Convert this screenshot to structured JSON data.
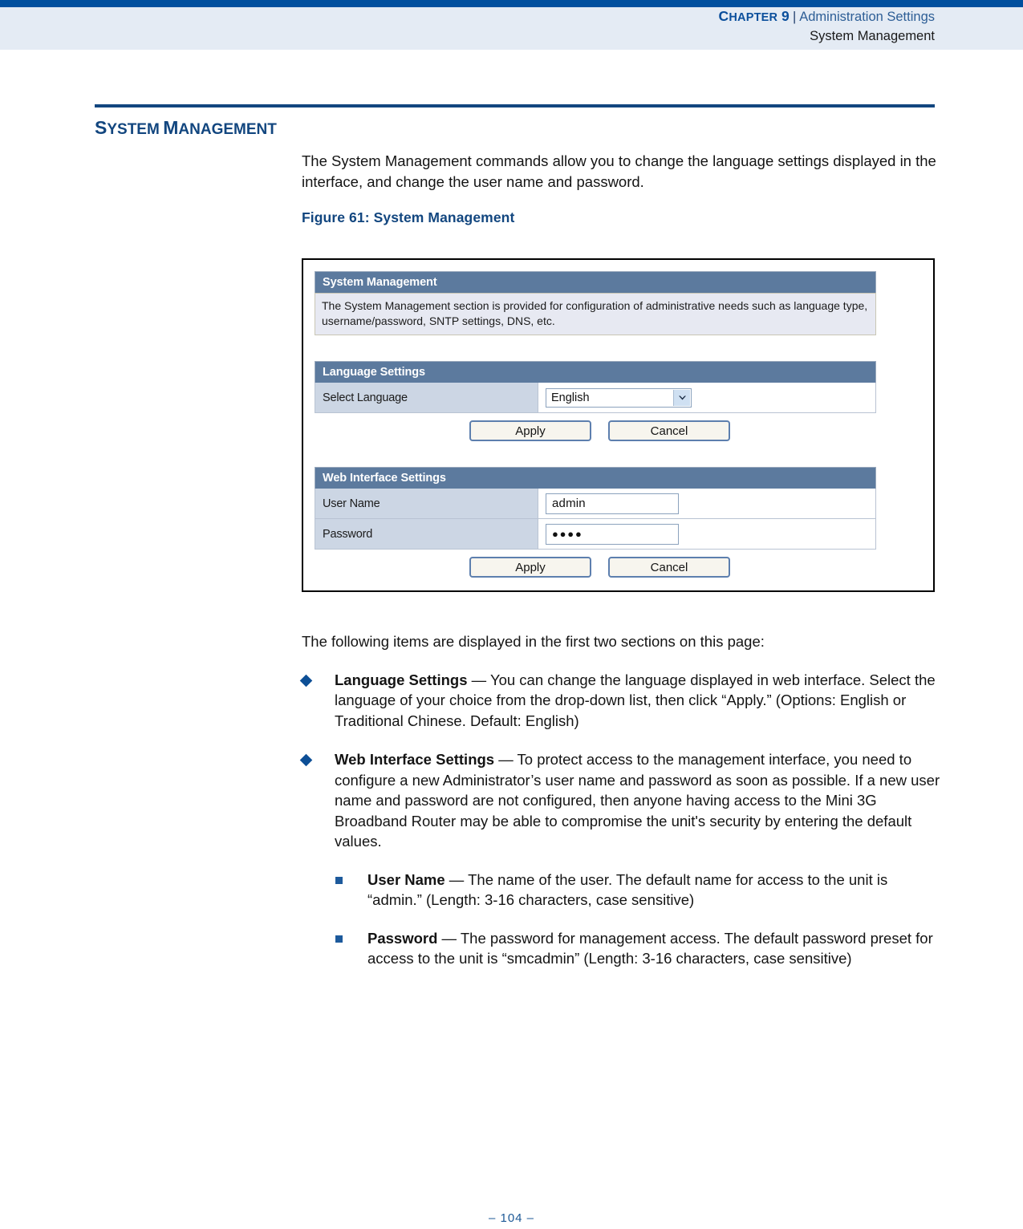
{
  "header": {
    "chapter_prefix_big": "C",
    "chapter_prefix_rest": "HAPTER",
    "chapter_number": "9",
    "separator": "|",
    "chapter_title": "Administration Settings",
    "subtitle": "System Management"
  },
  "section": {
    "title_parts": [
      {
        "big": "S",
        "small": "YSTEM"
      },
      {
        "big": "M",
        "small": "ANAGEMENT"
      }
    ],
    "title_plain": "SYSTEM MANAGEMENT"
  },
  "intro": {
    "paragraph": "The System Management commands allow you to change the language settings displayed in the interface, and change the user name and password."
  },
  "figure": {
    "caption": "Figure 61:  System Management",
    "ui": {
      "panel_title": "System Management",
      "panel_description": "The System Management section is provided for configuration of administrative needs such as language type, username/password, SNTP settings, DNS, etc.",
      "language_section": {
        "title": "Language Settings",
        "label": "Select Language",
        "selected_value": "English",
        "apply_label": "Apply",
        "cancel_label": "Cancel"
      },
      "web_section": {
        "title": "Web Interface Settings",
        "username_label": "User Name",
        "username_value": "admin",
        "password_label": "Password",
        "password_value": "●●●●",
        "apply_label": "Apply",
        "cancel_label": "Cancel"
      }
    }
  },
  "body": {
    "lead_in": "The following items are displayed in the first two sections on this page:",
    "bullets": [
      {
        "term": "Language Settings",
        "dash": " — ",
        "text": "You can change the language displayed in web interface. Select the language of your choice from the drop-down list, then click “Apply.” (Options: English or Traditional Chinese. Default: English)"
      },
      {
        "term": "Web Interface Settings",
        "dash": " — ",
        "text": "To protect access to the management interface, you need to configure a new Administrator’s user name and password as soon as possible. If a new user name and password are not configured, then anyone having access to the Mini 3G Broadband Router may be able to compromise the unit's security by entering the default values.",
        "sub_bullets": [
          {
            "term": "User Name",
            "dash": " — ",
            "text": "The name of the user. The default name for access to the unit is “admin.” (Length: 3-16 characters, case sensitive)"
          },
          {
            "term": "Password",
            "dash": " — ",
            "text": "The password for management access. The default password preset for access to the unit is “smcadmin” (Length: 3-16 characters, case sensitive)"
          }
        ]
      }
    ]
  },
  "footer": {
    "page_number": "–  104  –"
  },
  "colors": {
    "header_rule": "#004f9e",
    "header_band": "#e4ebf4",
    "heading_blue": "#12467f",
    "link_blue": "#2d5e96",
    "panel_title_bar": "#5c7a9e",
    "panel_desc_bg": "#e7e9f2",
    "row_label_bg": "#ccd6e4",
    "bullet_blue": "#0d4f96",
    "footer_blue": "#1c5896"
  }
}
